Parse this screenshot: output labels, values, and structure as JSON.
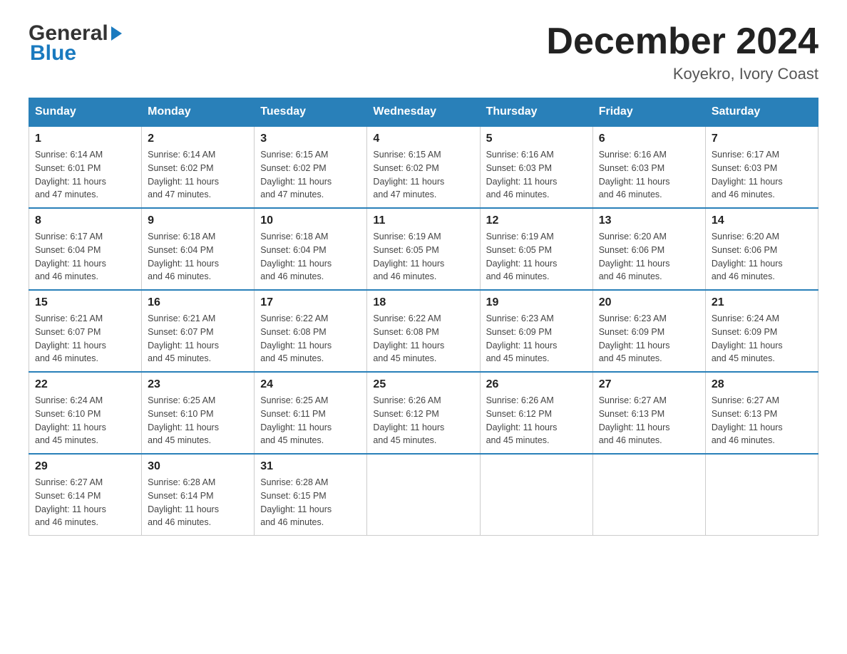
{
  "header": {
    "logo_general": "General",
    "logo_blue": "Blue",
    "month_title": "December 2024",
    "location": "Koyekro, Ivory Coast"
  },
  "days_of_week": [
    "Sunday",
    "Monday",
    "Tuesday",
    "Wednesday",
    "Thursday",
    "Friday",
    "Saturday"
  ],
  "weeks": [
    [
      {
        "day": "1",
        "sunrise": "6:14 AM",
        "sunset": "6:01 PM",
        "daylight": "11 hours and 47 minutes."
      },
      {
        "day": "2",
        "sunrise": "6:14 AM",
        "sunset": "6:02 PM",
        "daylight": "11 hours and 47 minutes."
      },
      {
        "day": "3",
        "sunrise": "6:15 AM",
        "sunset": "6:02 PM",
        "daylight": "11 hours and 47 minutes."
      },
      {
        "day": "4",
        "sunrise": "6:15 AM",
        "sunset": "6:02 PM",
        "daylight": "11 hours and 47 minutes."
      },
      {
        "day": "5",
        "sunrise": "6:16 AM",
        "sunset": "6:03 PM",
        "daylight": "11 hours and 46 minutes."
      },
      {
        "day": "6",
        "sunrise": "6:16 AM",
        "sunset": "6:03 PM",
        "daylight": "11 hours and 46 minutes."
      },
      {
        "day": "7",
        "sunrise": "6:17 AM",
        "sunset": "6:03 PM",
        "daylight": "11 hours and 46 minutes."
      }
    ],
    [
      {
        "day": "8",
        "sunrise": "6:17 AM",
        "sunset": "6:04 PM",
        "daylight": "11 hours and 46 minutes."
      },
      {
        "day": "9",
        "sunrise": "6:18 AM",
        "sunset": "6:04 PM",
        "daylight": "11 hours and 46 minutes."
      },
      {
        "day": "10",
        "sunrise": "6:18 AM",
        "sunset": "6:04 PM",
        "daylight": "11 hours and 46 minutes."
      },
      {
        "day": "11",
        "sunrise": "6:19 AM",
        "sunset": "6:05 PM",
        "daylight": "11 hours and 46 minutes."
      },
      {
        "day": "12",
        "sunrise": "6:19 AM",
        "sunset": "6:05 PM",
        "daylight": "11 hours and 46 minutes."
      },
      {
        "day": "13",
        "sunrise": "6:20 AM",
        "sunset": "6:06 PM",
        "daylight": "11 hours and 46 minutes."
      },
      {
        "day": "14",
        "sunrise": "6:20 AM",
        "sunset": "6:06 PM",
        "daylight": "11 hours and 46 minutes."
      }
    ],
    [
      {
        "day": "15",
        "sunrise": "6:21 AM",
        "sunset": "6:07 PM",
        "daylight": "11 hours and 46 minutes."
      },
      {
        "day": "16",
        "sunrise": "6:21 AM",
        "sunset": "6:07 PM",
        "daylight": "11 hours and 45 minutes."
      },
      {
        "day": "17",
        "sunrise": "6:22 AM",
        "sunset": "6:08 PM",
        "daylight": "11 hours and 45 minutes."
      },
      {
        "day": "18",
        "sunrise": "6:22 AM",
        "sunset": "6:08 PM",
        "daylight": "11 hours and 45 minutes."
      },
      {
        "day": "19",
        "sunrise": "6:23 AM",
        "sunset": "6:09 PM",
        "daylight": "11 hours and 45 minutes."
      },
      {
        "day": "20",
        "sunrise": "6:23 AM",
        "sunset": "6:09 PM",
        "daylight": "11 hours and 45 minutes."
      },
      {
        "day": "21",
        "sunrise": "6:24 AM",
        "sunset": "6:09 PM",
        "daylight": "11 hours and 45 minutes."
      }
    ],
    [
      {
        "day": "22",
        "sunrise": "6:24 AM",
        "sunset": "6:10 PM",
        "daylight": "11 hours and 45 minutes."
      },
      {
        "day": "23",
        "sunrise": "6:25 AM",
        "sunset": "6:10 PM",
        "daylight": "11 hours and 45 minutes."
      },
      {
        "day": "24",
        "sunrise": "6:25 AM",
        "sunset": "6:11 PM",
        "daylight": "11 hours and 45 minutes."
      },
      {
        "day": "25",
        "sunrise": "6:26 AM",
        "sunset": "6:12 PM",
        "daylight": "11 hours and 45 minutes."
      },
      {
        "day": "26",
        "sunrise": "6:26 AM",
        "sunset": "6:12 PM",
        "daylight": "11 hours and 45 minutes."
      },
      {
        "day": "27",
        "sunrise": "6:27 AM",
        "sunset": "6:13 PM",
        "daylight": "11 hours and 46 minutes."
      },
      {
        "day": "28",
        "sunrise": "6:27 AM",
        "sunset": "6:13 PM",
        "daylight": "11 hours and 46 minutes."
      }
    ],
    [
      {
        "day": "29",
        "sunrise": "6:27 AM",
        "sunset": "6:14 PM",
        "daylight": "11 hours and 46 minutes."
      },
      {
        "day": "30",
        "sunrise": "6:28 AM",
        "sunset": "6:14 PM",
        "daylight": "11 hours and 46 minutes."
      },
      {
        "day": "31",
        "sunrise": "6:28 AM",
        "sunset": "6:15 PM",
        "daylight": "11 hours and 46 minutes."
      },
      null,
      null,
      null,
      null
    ]
  ],
  "labels": {
    "sunrise": "Sunrise:",
    "sunset": "Sunset:",
    "daylight": "Daylight:"
  }
}
